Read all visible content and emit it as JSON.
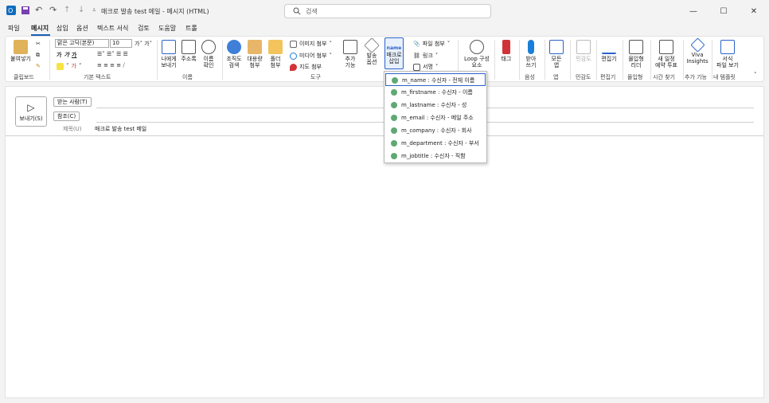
{
  "title_bar": {
    "window_title": "매크로 발송 test 메일  -  메시지 (HTML)",
    "search_placeholder": "검색"
  },
  "menu": [
    "파일",
    "메시지",
    "삽입",
    "옵션",
    "텍스트 서식",
    "검토",
    "도움말",
    "트롤"
  ],
  "active_menu": "메시지",
  "ribbon": {
    "paste": "붙여넣기",
    "font_name": "맑은 고딕(본문)",
    "font_size": "10",
    "to_me": [
      "나에게",
      "보내기"
    ],
    "address_book": "주소록",
    "check_names": [
      "이름",
      "확인"
    ],
    "org_search": [
      "조직도",
      "검색"
    ],
    "large_attach": [
      "대용량",
      "첨부"
    ],
    "folder_attach": [
      "폴더",
      "첨부"
    ],
    "image_attach": "이미지 첨부",
    "media_attach": "미디어 첨부",
    "map_attach": "지도 첨부",
    "add_func": [
      "추가",
      "기능"
    ],
    "send_options": [
      "발송",
      "옵션"
    ],
    "macro_icon_text": "name",
    "macro_insert": [
      "매크로",
      "삽입"
    ],
    "file_attach": "파일 첨부",
    "link": "링크",
    "signature": "서명",
    "loop": [
      "Loop 구성",
      "요소"
    ],
    "tags": "태그",
    "dictate": [
      "받아",
      "쓰기"
    ],
    "all_apps": [
      "모든",
      "앱"
    ],
    "sensitivity": "민감도",
    "editor": "편집기",
    "immersive_reader": [
      "몰입형",
      "리더"
    ],
    "new_schedule": [
      "새 일정",
      "예약 투표"
    ],
    "viva": [
      "Viva",
      "Insights"
    ],
    "view_templates": [
      "서식",
      "파일 보기"
    ],
    "groups": {
      "clipboard": "클립보드",
      "basic_text": "기본 텍스트",
      "names": "이름",
      "tools": "도구",
      "voice": "음성",
      "apps": "앱",
      "sensitivity": "민감도",
      "editor": "편집기",
      "immersive": "몰입형",
      "find_time": "시간 찾기",
      "addins": "추가 기능",
      "my_templates": "내 템플릿"
    }
  },
  "compose": {
    "send": "보내기(S)",
    "to": "받는 사람(T)",
    "cc": "참조(C)",
    "subject_label": "제목(U)",
    "subject_value": "매크로 발송 test 메일"
  },
  "macro_menu": [
    "m_name : 수신자 - 전체 이름",
    "m_firstname : 수신자 - 이름",
    "m_lastname : 수신자 - 성",
    "m_email : 수신자 - 메일 주소",
    "m_company : 수신자 - 회사",
    "m_department : 수신자 - 부서",
    "m_jobtitle : 수신자 - 직함"
  ],
  "colors": {
    "accent": "#2a62c9",
    "outlook_blue": "#0f6cbd",
    "flag_red": "#d13438"
  }
}
